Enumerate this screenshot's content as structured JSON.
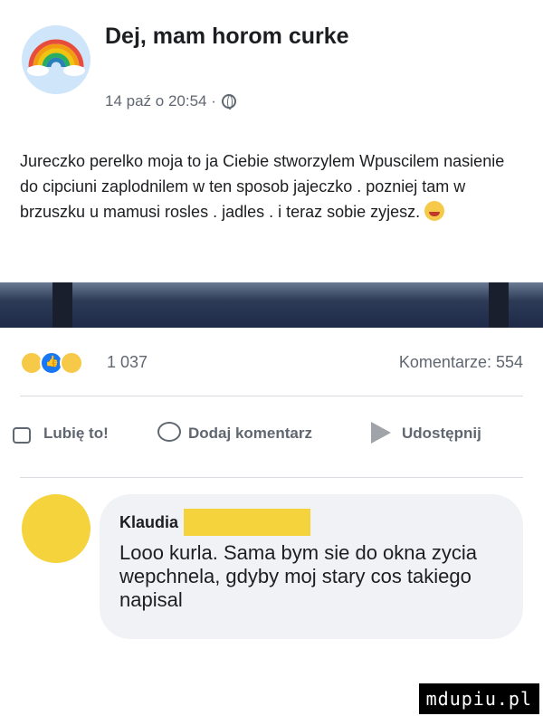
{
  "post": {
    "author": "Dej, mam horom curke",
    "timestamp": "14 paź o 20:54 ·",
    "privacy_icon": "globe-icon",
    "text": "Jureczko perelko moja to ja Ciebie stworzylem Wpuscilem nasienie do cipciuni zaplodnilem w ten sposob jajeczko . pozniej tam w brzuszku u mamusi rosles . jadles . i teraz sobie zyjesz."
  },
  "reactions": {
    "icons": [
      "haha-icon",
      "like-icon",
      "wow-icon"
    ],
    "count": "1 037",
    "comments": "Komentarze: 554"
  },
  "actions": {
    "like": "Lubię to!",
    "comment": "Dodaj komentarz",
    "share": "Udostępnij"
  },
  "comment": {
    "author": "Klaudia",
    "text": "Looo kurla. Sama bym sie do okna zycia wepchnela, gdyby moj stary cos takiego napisal"
  },
  "watermark": "mdupiu.pl",
  "colors": {
    "accent": "#1877f2",
    "muted": "#606770",
    "bubble": "#f0f2f5",
    "redaction": "#f5d33c"
  }
}
